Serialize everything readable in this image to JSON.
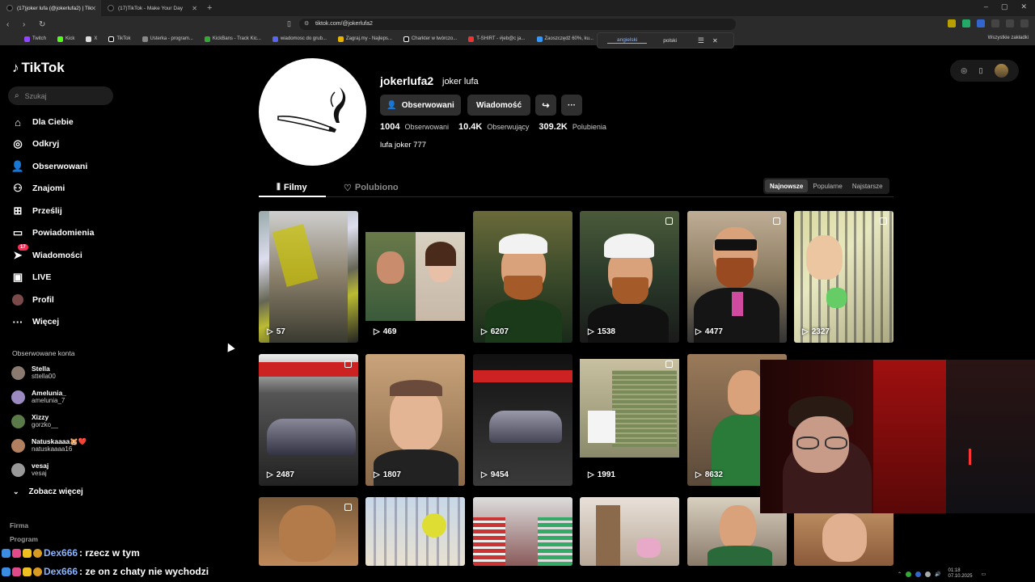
{
  "browser": {
    "tabs": [
      {
        "title": "(17)joker lufa (@jokerlufa2) | Tik"
      },
      {
        "title": "(17)TikTok - Make Your Day"
      }
    ],
    "url": "tiktok.com/@jokerlufa2",
    "bookmarks": [
      "Twitch",
      "Kick",
      "X",
      "TikTok",
      "Usterka - program...",
      "KickBans - Track Kic...",
      "wiadomosc do grub...",
      "Zagraj.my - Najleps...",
      "Charkter w twórczo...",
      "T-SHIRT - #jeb@c ja...",
      "Zaoszczędź 60%, ku..."
    ],
    "bookmarks_all": "Wszystkie zakładki",
    "translate": {
      "from": "angielski",
      "to": "polski"
    }
  },
  "sidebar": {
    "logo": "TikTok",
    "search_placeholder": "Szukaj",
    "items": [
      {
        "label": "Dla Ciebie"
      },
      {
        "label": "Odkryj"
      },
      {
        "label": "Obserwowani"
      },
      {
        "label": "Znajomi"
      },
      {
        "label": "Prześlij"
      },
      {
        "label": "Powiadomienia"
      },
      {
        "label": "Wiadomości",
        "badge": "17"
      },
      {
        "label": "LIVE"
      },
      {
        "label": "Profil"
      },
      {
        "label": "Więcej"
      }
    ],
    "followed_title": "Obserwowane konta",
    "accounts": [
      {
        "name": "Stella",
        "handle": "sttella00",
        "color": "#8a7a70"
      },
      {
        "name": "Amelunia_",
        "handle": "amelunia_7",
        "color": "#9a8ac0"
      },
      {
        "name": "Xizzy",
        "handle": "gorzko__",
        "color": "#5a7a4a"
      },
      {
        "name": "Natuskaaaa🐹❤️",
        "handle": "natuskaaaa16",
        "color": "#b08060"
      },
      {
        "name": "vesaj",
        "handle": "vesaj",
        "color": "#999999"
      }
    ],
    "see_more": "Zobacz więcej",
    "footer": [
      "Firma",
      "Program"
    ]
  },
  "profile": {
    "username": "jokerlufa2",
    "nickname": "joker lufa",
    "follow_button": "Obserwowani",
    "message_button": "Wiadomość",
    "stats": [
      {
        "value": "1004",
        "label": "Obserwowani"
      },
      {
        "value": "10.4K",
        "label": "Obserwujący"
      },
      {
        "value": "309.2K",
        "label": "Polubienia"
      }
    ],
    "bio": "lufa joker 777",
    "tabs": {
      "videos": "Filmy",
      "liked": "Polubiono"
    },
    "sort": [
      "Najnowsze",
      "Popularne",
      "Najstarsze"
    ]
  },
  "videos": [
    {
      "views": "57"
    },
    {
      "views": "469"
    },
    {
      "views": "6207"
    },
    {
      "views": "1538"
    },
    {
      "views": "4477"
    },
    {
      "views": "2327"
    },
    {
      "views": "2487"
    },
    {
      "views": "1807"
    },
    {
      "views": "9454"
    },
    {
      "views": "1991"
    },
    {
      "views": "8632"
    },
    {
      "views": ""
    },
    {
      "views": ""
    },
    {
      "views": ""
    },
    {
      "views": ""
    },
    {
      "views": ""
    },
    {
      "views": ""
    },
    {
      "views": ""
    }
  ],
  "chat": [
    {
      "user": "Dex666",
      "message": ": rzecz w tym"
    },
    {
      "user": "Dex666",
      "message": ": ze on z chaty nie wychodzi"
    }
  ],
  "taskbar": {
    "time": "01:18",
    "date": "07.10.2025"
  }
}
